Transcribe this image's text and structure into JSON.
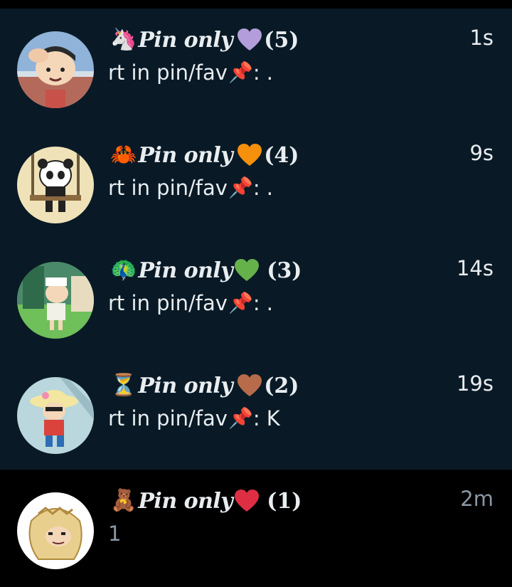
{
  "conversations": [
    {
      "emoji": "🦄",
      "name": "Pin only",
      "heart_icon": "purple-heart-icon",
      "heart_color": "#b39ddb",
      "count": "(5)",
      "count_spaced": false,
      "preview_text": "rt in pin/fav",
      "preview_icon": "📌",
      "preview_suffix": ": .",
      "time": "1s",
      "read": false
    },
    {
      "emoji": "🦀",
      "name": "Pin only",
      "heart_icon": "orange-heart-icon",
      "heart_color": "#f4900c",
      "count": "(4)",
      "count_spaced": false,
      "preview_text": "rt in pin/fav",
      "preview_icon": "📌",
      "preview_suffix": ": .",
      "time": "9s",
      "read": false
    },
    {
      "emoji": "🦚",
      "name": "Pin only",
      "heart_icon": "green-heart-icon",
      "heart_color": "#65b24b",
      "count": "(3)",
      "count_spaced": true,
      "preview_text": "rt in pin/fav",
      "preview_icon": "📌",
      "preview_suffix": ": .",
      "time": "14s",
      "read": false
    },
    {
      "emoji": "⏳",
      "name": "Pin only",
      "heart_icon": "brown-heart-icon",
      "heart_color": "#b86b4a",
      "count": "(2)",
      "count_spaced": false,
      "preview_text": "rt in pin/fav",
      "preview_icon": "📌",
      "preview_suffix": ": K",
      "time": "19s",
      "read": false
    },
    {
      "emoji": "🧸",
      "name": "Pin only",
      "heart_icon": "red-heart-icon",
      "heart_color": "#dd2e44",
      "count": "(1)",
      "count_spaced": true,
      "preview_text": "1",
      "preview_icon": "",
      "preview_suffix": "",
      "time": "2m",
      "read": true
    }
  ],
  "colors": {
    "unread_background": "#091a26",
    "read_background": "#000000",
    "text_primary": "#e9edf0",
    "text_muted": "#8b98a5"
  }
}
